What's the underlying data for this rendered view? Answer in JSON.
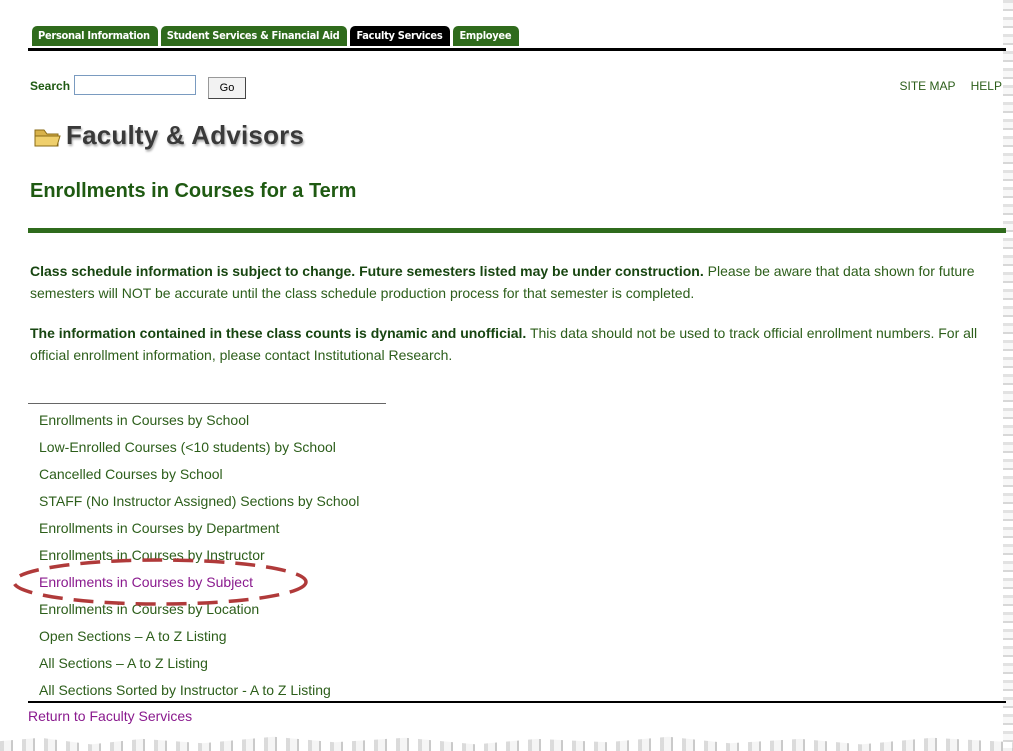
{
  "tabs": [
    {
      "label": "Personal Information"
    },
    {
      "label": "Student Services & Financial Aid"
    },
    {
      "label": "Faculty Services"
    },
    {
      "label": "Employee"
    }
  ],
  "active_tab": "Faculty Services",
  "search": {
    "label": "Search",
    "value": "",
    "button_label": "Go"
  },
  "toplinks": {
    "site_map": "SITE MAP",
    "help": "HELP"
  },
  "header": {
    "app_title": "Faculty & Advisors",
    "page_title": "Enrollments in Courses for a Term"
  },
  "notices": [
    {
      "bold": "Class schedule information is subject to change. Future semesters listed may be under construction.",
      "text": " Please be aware that data shown for future semesters will NOT be accurate until the class schedule production process for that semester is completed."
    },
    {
      "bold": "The information contained in these class counts is dynamic and unofficial.",
      "text": " This data should not be used to track official enrollment numbers. For all official enrollment information, please contact Institutional Research."
    }
  ],
  "links": [
    {
      "label": "Enrollments in Courses by School"
    },
    {
      "label": "Low-Enrolled Courses (<10 students) by School"
    },
    {
      "label": "Cancelled Courses by School"
    },
    {
      "label": "STAFF (No Instructor Assigned) Sections by School"
    },
    {
      "label": "Enrollments in Courses by Department"
    },
    {
      "label": "Enrollments in Courses by Instructor"
    },
    {
      "label": "Enrollments in Courses by Subject"
    },
    {
      "label": "Enrollments in Courses by Location"
    },
    {
      "label": "Open Sections – A to Z Listing"
    },
    {
      "label": "All Sections – A to Z Listing"
    },
    {
      "label": "All Sections Sorted by Instructor - A to Z Listing"
    }
  ],
  "highlighted_link": "Enrollments in Courses by Subject",
  "footer": {
    "return_link": "Return to Faculty Services"
  },
  "colors": {
    "tab_green": "#2f6b1c",
    "text_green": "#2c5e1a",
    "visited_purple": "#8a1a8e",
    "highlight_red": "#b03a3a"
  },
  "icons": {
    "title_icon": "folder-icon"
  }
}
